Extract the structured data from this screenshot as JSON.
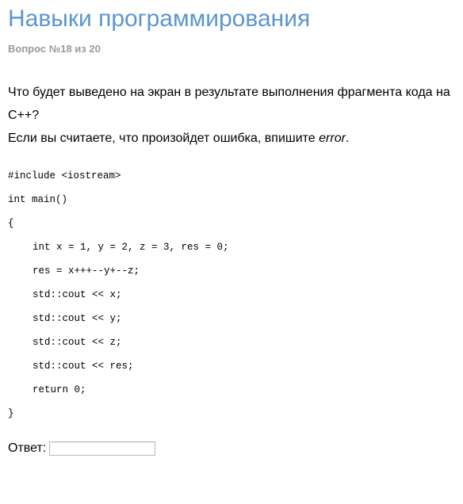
{
  "header": {
    "title": "Навыки программирования",
    "counter": "Вопрос №18 из 20"
  },
  "question": {
    "line1": "Что будет выведено на экран в результате выполнения фрагмента кода на С++?",
    "line2_prefix": "Если вы считаете, что произойдет ошибка, впишите ",
    "line2_emph": "error",
    "line2_suffix": "."
  },
  "code": {
    "lines": [
      {
        "text": "#include <iostream>",
        "indent": false
      },
      {
        "text": "int main()",
        "indent": false
      },
      {
        "text": "{",
        "indent": false
      },
      {
        "text": "int x = 1, y = 2, z = 3, res = 0;",
        "indent": true
      },
      {
        "text": "res = x+++--y+--z;",
        "indent": true
      },
      {
        "text": "std::cout << x;",
        "indent": true
      },
      {
        "text": "std::cout << y;",
        "indent": true
      },
      {
        "text": "std::cout << z;",
        "indent": true
      },
      {
        "text": "std::cout << res;",
        "indent": true
      },
      {
        "text": "return 0;",
        "indent": true
      },
      {
        "text": "}",
        "indent": false
      }
    ]
  },
  "answer": {
    "label": "Ответ:",
    "value": "",
    "placeholder": ""
  },
  "colors": {
    "title": "#5b96cf",
    "counter": "#9a9a9a",
    "text": "#000000"
  }
}
